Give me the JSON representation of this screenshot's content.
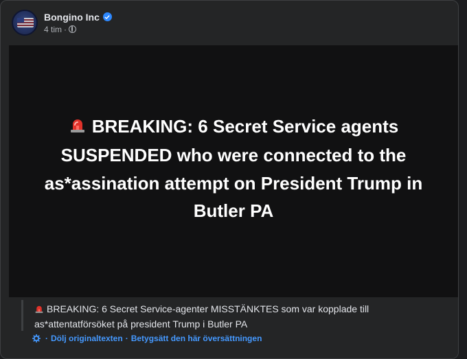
{
  "post": {
    "author": "Bongino Inc",
    "time": "4 tim",
    "time_sep": "·",
    "headline": "BREAKING: 6 Secret Service agents SUSPENDED who were connected to the as*assination attempt on President Trump in Butler PA",
    "translation": "BREAKING: 6 Secret Service-agenter MISSTÄNKTES som var kopplade till as*attentatförsöket på president Trump i Butler PA",
    "hide_original_label": "Dölj originaltexten",
    "links_sep": "·",
    "rate_translation_label": "Betygsätt den här översättningen",
    "leading_sep": "·"
  },
  "icons": {
    "verified": "verified-badge-icon",
    "privacy": "globe-icon",
    "headline_emoji": "police-siren-icon",
    "translate": "gear-icon"
  },
  "colors": {
    "card_bg": "#242526",
    "media_bg": "#111112",
    "link": "#4599ff",
    "verified": "#2d88ff",
    "siren": "#e0322a"
  }
}
